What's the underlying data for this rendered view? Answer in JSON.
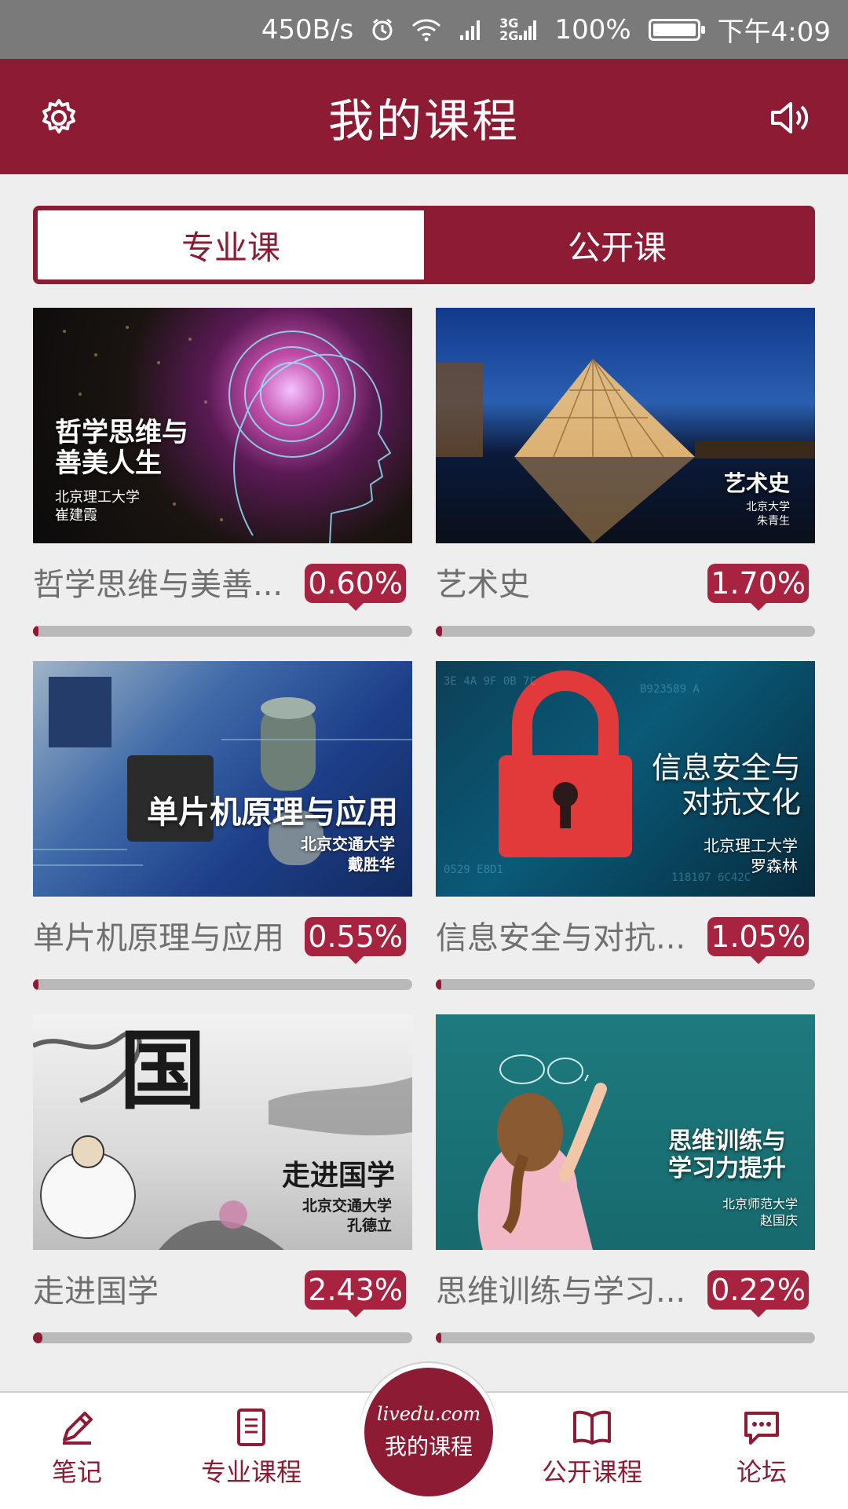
{
  "status_bar": {
    "net_speed": "450B/s",
    "network_gen_top": "3G",
    "network_gen_bottom": "2G",
    "battery": "100%",
    "time": "下午4:09"
  },
  "header": {
    "title": "我的课程"
  },
  "tabs": [
    {
      "label": "专业课",
      "active": true
    },
    {
      "label": "公开课",
      "active": false
    }
  ],
  "courses": [
    {
      "name": "哲学思维与美善...",
      "progress_label": "0.60%",
      "progress": 0.006,
      "thumb_title": "哲学思维与\n善美人生",
      "thumb_school": "北京理工大学",
      "thumb_teacher": "崔建霞"
    },
    {
      "name": "艺术史",
      "progress_label": "1.70%",
      "progress": 0.017,
      "thumb_title": "艺术史",
      "thumb_school": "北京大学",
      "thumb_teacher": "朱青生"
    },
    {
      "name": "单片机原理与应用",
      "progress_label": "0.55%",
      "progress": 0.0055,
      "thumb_title": "单片机原理与应用",
      "thumb_school": "北京交通大学",
      "thumb_teacher": "戴胜华"
    },
    {
      "name": "信息安全与对抗...",
      "progress_label": "1.05%",
      "progress": 0.0105,
      "thumb_title": "信息安全与\n对抗文化",
      "thumb_school": "北京理工大学",
      "thumb_teacher": "罗森林"
    },
    {
      "name": "走进国学",
      "progress_label": "2.43%",
      "progress": 0.0243,
      "thumb_title": "走进国学",
      "thumb_school": "北京交通大学",
      "thumb_teacher": "孔德立"
    },
    {
      "name": "思维训练与学习...",
      "progress_label": "0.22%",
      "progress": 0.0022,
      "thumb_title": "思维训练与\n学习力提升",
      "thumb_school": "北京师范大学",
      "thumb_teacher": "赵国庆"
    }
  ],
  "bottom_nav": {
    "notes": "笔记",
    "major": "专业课程",
    "center_logo": "livedu.com",
    "center_label": "我的课程",
    "public": "公开课程",
    "forum": "论坛"
  },
  "colors": {
    "brand": "#8c1b33",
    "badge": "#a8233f",
    "track": "#b9b9b9",
    "background": "#eeeeee"
  },
  "icons": [
    "settings-icon",
    "speaker-icon",
    "pencil-icon",
    "notebook-icon",
    "book-icon",
    "chat-icon",
    "alarm-icon",
    "wifi-icon",
    "signal-icon",
    "battery-icon"
  ]
}
